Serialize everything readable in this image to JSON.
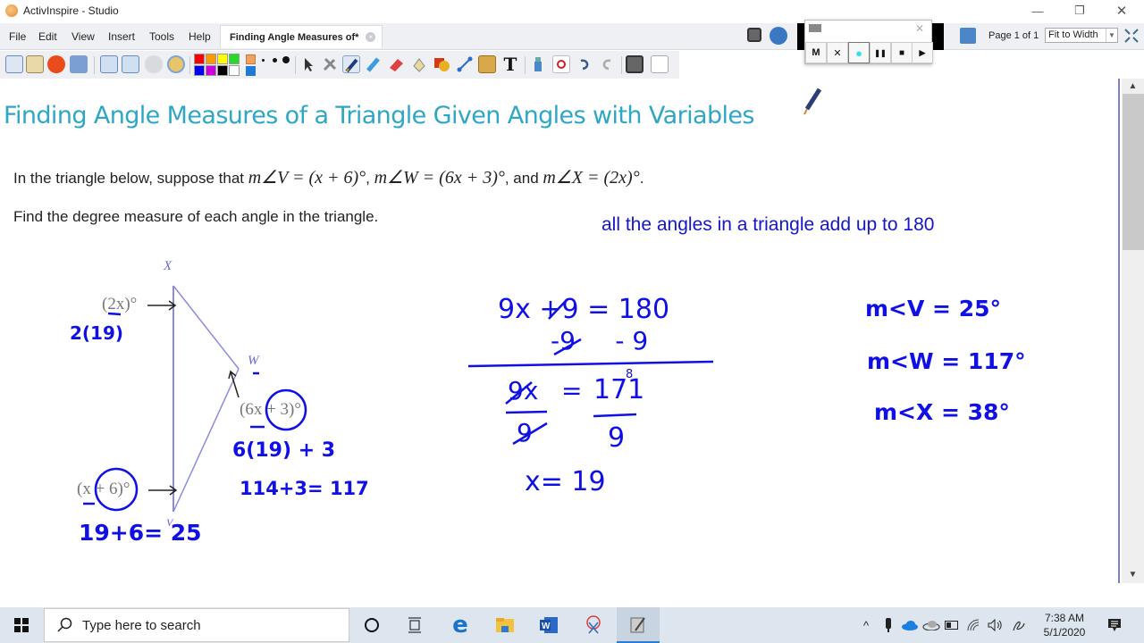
{
  "window": {
    "title": "ActivInspire - Studio",
    "controls": {
      "minimize": "—",
      "restore": "❐",
      "close": "✕"
    }
  },
  "menu": {
    "items": [
      "File",
      "Edit",
      "View",
      "Insert",
      "Tools",
      "Help"
    ]
  },
  "document_tab": {
    "label": "Finding Angle Measures of*",
    "close": "×"
  },
  "toolbar": {
    "colors": [
      "#ff0000",
      "#ff9900",
      "#ffff00",
      "#22dd22",
      "#0000ee",
      "#cc00dd",
      "#000000",
      "#ffffff"
    ],
    "text_tool_glyph": "T"
  },
  "recorder": {
    "buttons": [
      "M",
      "✕",
      "●",
      "❚❚",
      "■",
      "▶"
    ],
    "close": "✕"
  },
  "page_nav": {
    "label": "Page 1 of 1",
    "zoom_value": "Fit to Width"
  },
  "flipchart": {
    "title": "Finding Angle Measures of a Triangle Given Angles with Variables",
    "problem_prefix": "In the triangle below, suppose that ",
    "angle_v": "m∠V = (x + 6)°",
    "angle_w": "m∠W = (6x + 3)°",
    "and": ", and ",
    "angle_x": "m∠X = (2x)°",
    "period": ".",
    "instruction": "Find the degree measure of each angle in the triangle.",
    "note": "all the angles in a triangle add up to 180",
    "figure": {
      "vertex_x": "X",
      "vertex_w": "W",
      "vertex_v": "V",
      "expr_x": "(2x)°",
      "expr_w": "(6x + 3)°",
      "expr_v": "(x + 6)°"
    },
    "handwriting": {
      "sub_x": "2(19)",
      "sub_w": "6(19) + 3",
      "calc_w": "114+3= 117",
      "calc_v": "19+6= 25",
      "eq1": "9x +9 = 180",
      "eq2": "-9     - 9",
      "eq3_left": "9x",
      "eq3_eq": "=",
      "eq3_right": "171",
      "eq3_left_den": "9",
      "eq3_right_den": "9",
      "eq3_carry": "8",
      "result": "x= 19",
      "ans_v": "m<V = 25°",
      "ans_w": "m<W = 117°",
      "ans_x": "m<X = 38°"
    }
  },
  "taskbar": {
    "search_placeholder": "Type here to search",
    "time": "7:38 AM",
    "date": "5/1/2020"
  }
}
